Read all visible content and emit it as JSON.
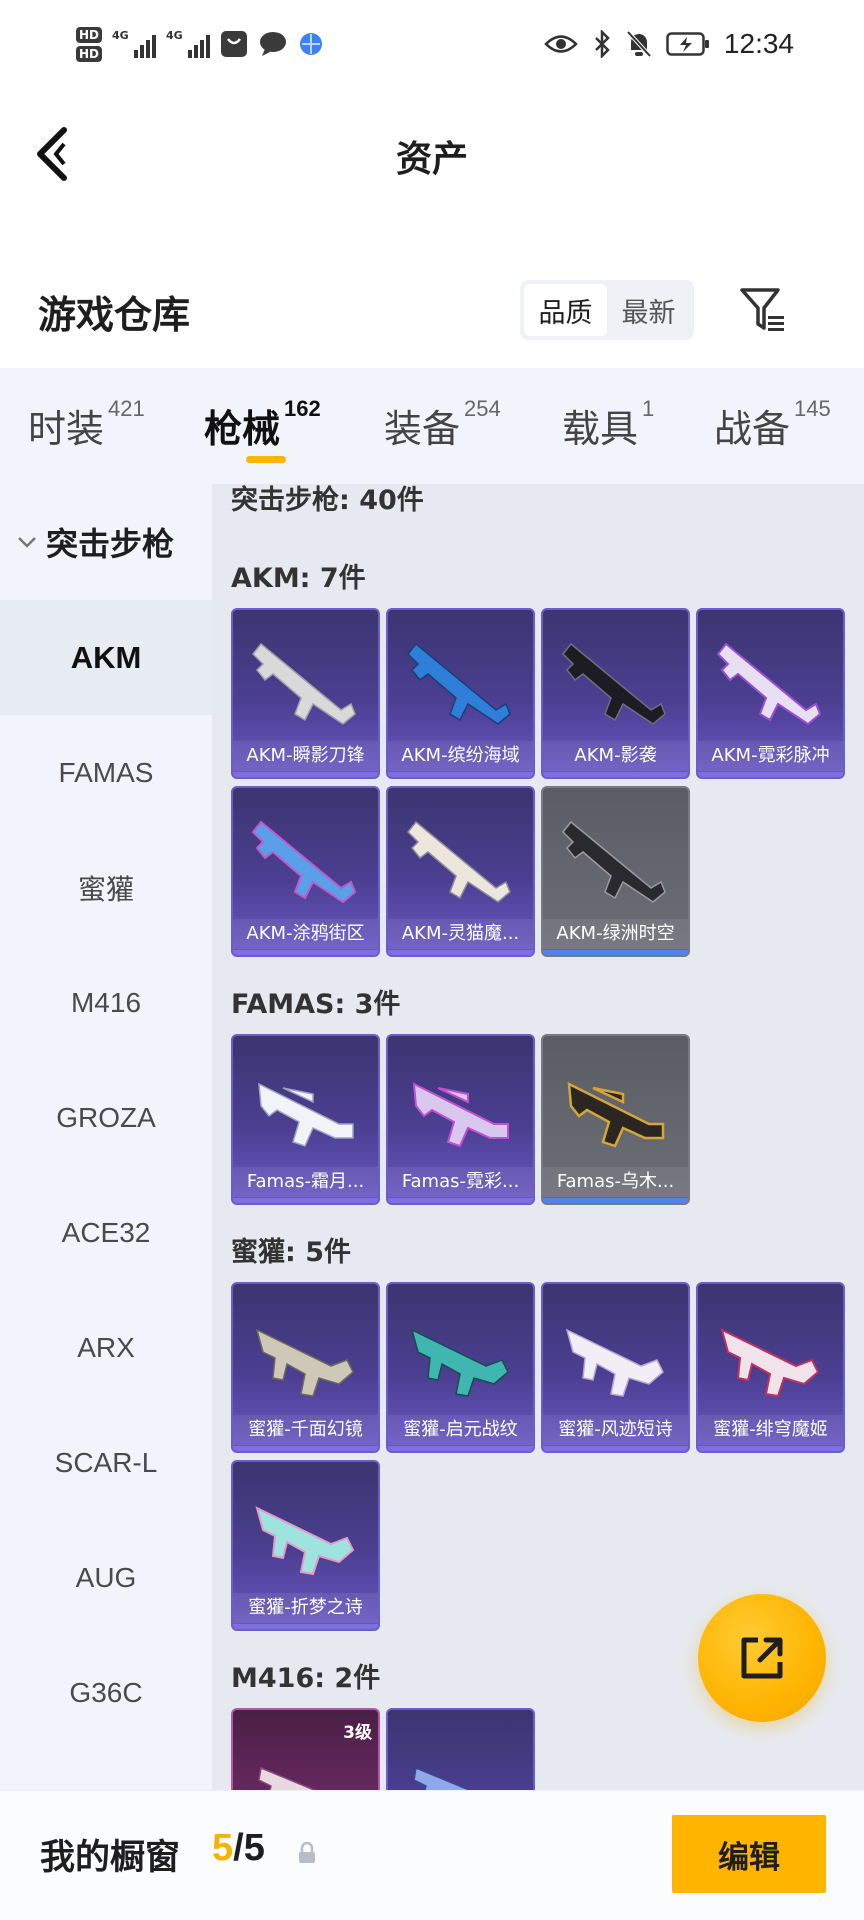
{
  "status_bar": {
    "hd1": "HD",
    "hd2": "HD",
    "net1": "4G",
    "net2": "4G",
    "time": "12:34",
    "icons": [
      "eye-icon",
      "bluetooth-icon",
      "bell-off-icon",
      "battery-charging-icon",
      "chat-icon",
      "browser-icon"
    ]
  },
  "header": {
    "title": "资产",
    "back_icon": "chevron-left-icon"
  },
  "warehouse": {
    "title": "游戏仓库",
    "sort_options": [
      "品质",
      "最新"
    ],
    "active_sort": "品质",
    "filter_icon": "filter-icon"
  },
  "tabs": [
    {
      "label": "时装",
      "count": "421"
    },
    {
      "label": "枪械",
      "count": "162"
    },
    {
      "label": "装备",
      "count": "254"
    },
    {
      "label": "载具",
      "count": "1"
    },
    {
      "label": "战备",
      "count": "145"
    }
  ],
  "active_tab": "枪械",
  "sidebar": {
    "group": "突击步枪",
    "items": [
      "AKM",
      "FAMAS",
      "蜜獾",
      "M416",
      "GROZA",
      "ACE32",
      "ARX",
      "SCAR-L",
      "AUG",
      "G36C"
    ],
    "active": "AKM"
  },
  "content": {
    "category_header": "突击步枪: 40件",
    "sections": [
      {
        "title": "AKM: 7件",
        "items": [
          {
            "name": "AKM-瞬影刀锋"
          },
          {
            "name": "AKM-缤纷海域"
          },
          {
            "name": "AKM-影袭"
          },
          {
            "name": "AKM-霓彩脉冲"
          },
          {
            "name": "AKM-涂鸦街区"
          },
          {
            "name": "AKM-灵猫魔..."
          },
          {
            "name": "AKM-绿洲时空"
          }
        ]
      },
      {
        "title": "FAMAS: 3件",
        "items": [
          {
            "name": "Famas-霜月..."
          },
          {
            "name": "Famas-霓彩..."
          },
          {
            "name": "Famas-乌木..."
          }
        ]
      },
      {
        "title": "蜜獾: 5件",
        "items": [
          {
            "name": "蜜獾-千面幻镜"
          },
          {
            "name": "蜜獾-启元战纹"
          },
          {
            "name": "蜜獾-风迹短诗"
          },
          {
            "name": "蜜獾-绯穹魔姬"
          },
          {
            "name": "蜜獾-折梦之诗"
          }
        ]
      },
      {
        "title": "M416: 2件",
        "items": [
          {
            "name": "",
            "badge": "3级"
          },
          {
            "name": ""
          }
        ]
      }
    ]
  },
  "fab": {
    "icon": "share-external-icon"
  },
  "bottom_bar": {
    "title": "我的橱窗",
    "count_current": "5",
    "count_sep": "/",
    "count_total": "5",
    "lock_icon": "lock-icon",
    "edit_label": "编辑"
  }
}
